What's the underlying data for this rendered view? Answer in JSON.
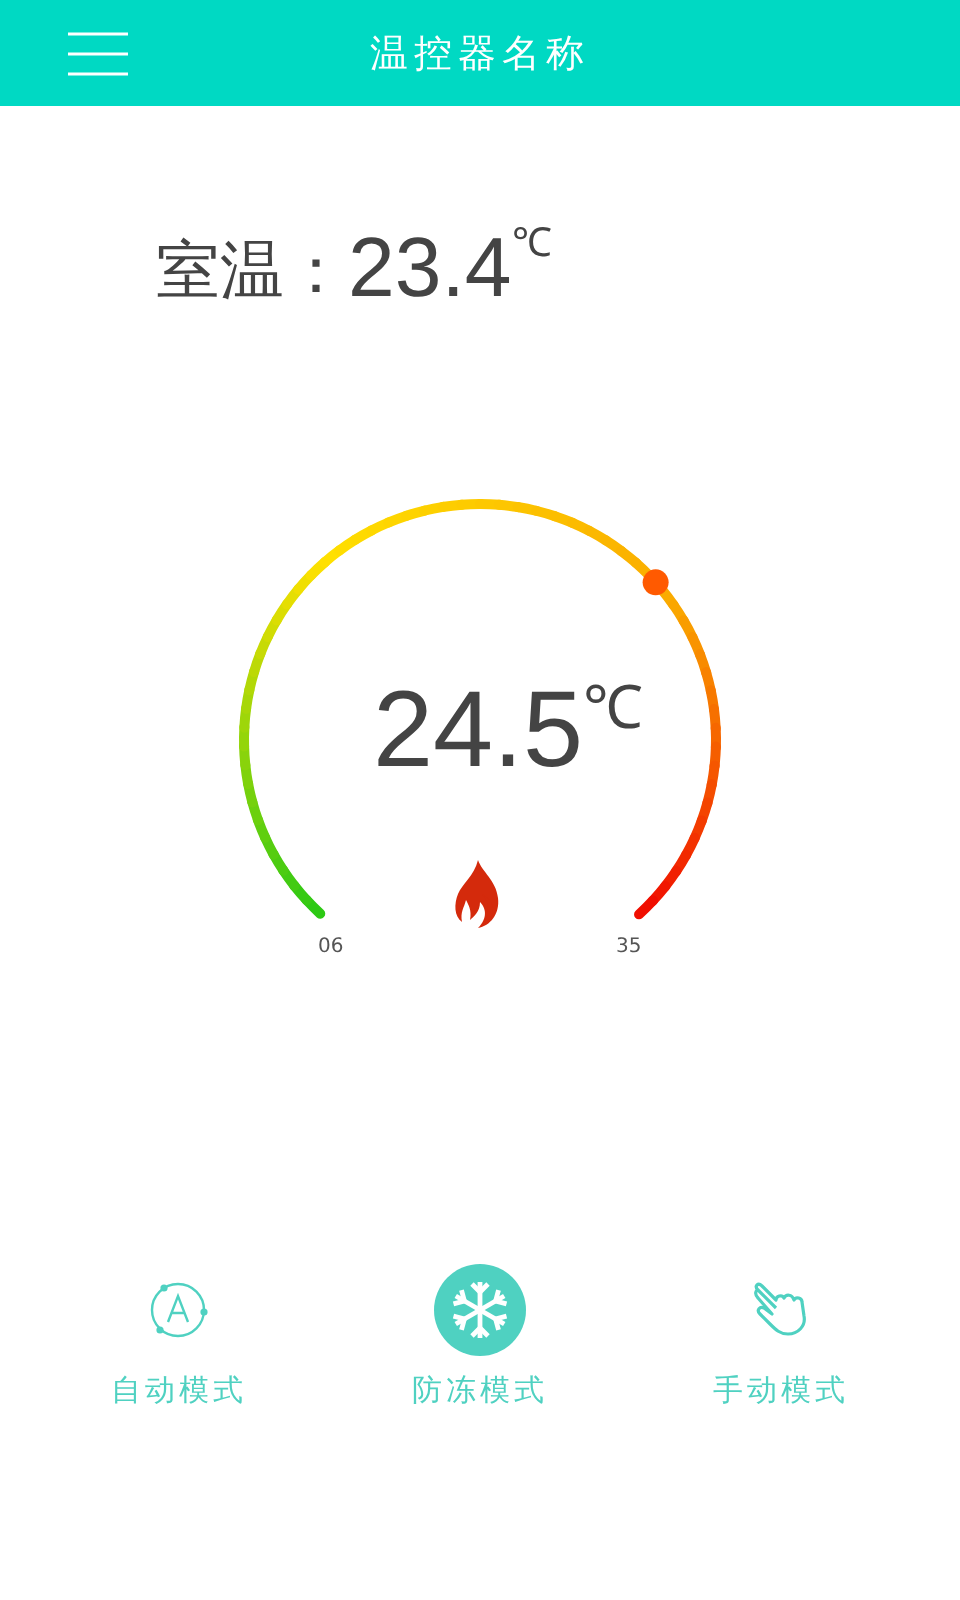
{
  "header": {
    "title": "温控器名称"
  },
  "room": {
    "label": "室温：",
    "value": "23.4",
    "unit": "℃"
  },
  "gauge": {
    "value": "24.5",
    "unit": "℃",
    "min_label": "06",
    "max_label": "35",
    "heating": true
  },
  "modes": [
    {
      "kind": "auto",
      "label": "自动模式",
      "selected": false
    },
    {
      "kind": "antifreeze",
      "label": "防冻模式",
      "selected": true
    },
    {
      "kind": "manual",
      "label": "手动模式",
      "selected": false
    }
  ]
}
